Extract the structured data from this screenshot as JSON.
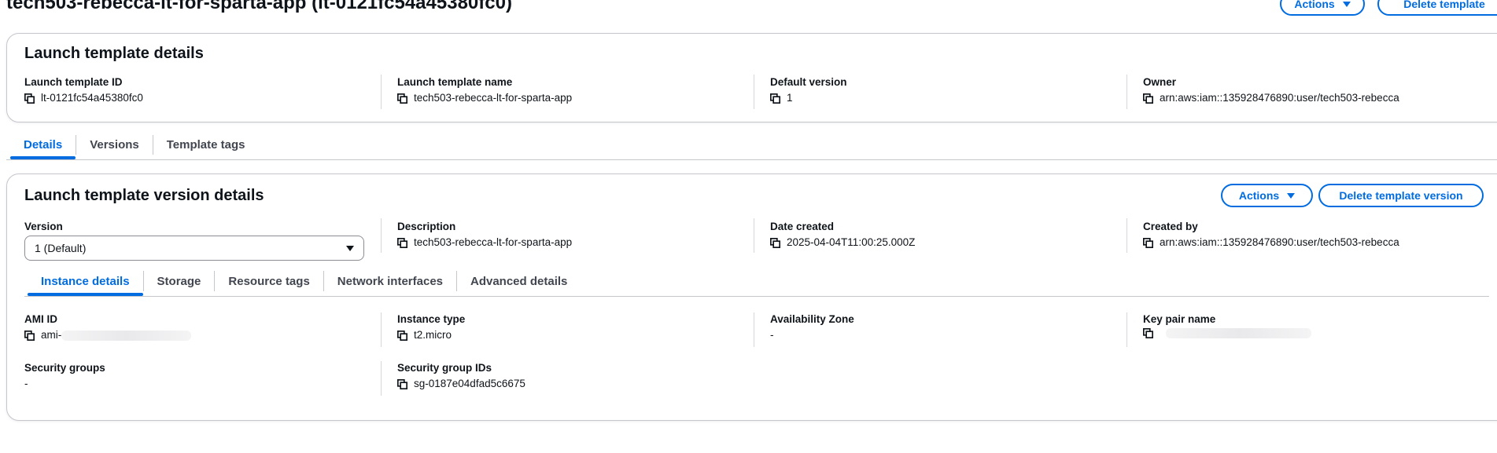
{
  "page": {
    "title": "tech503-rebecca-lt-for-sparta-app (lt-0121fc54a45380fc0)",
    "actions_label": "Actions",
    "delete_label": "Delete template"
  },
  "details_card": {
    "title": "Launch template details",
    "fields": [
      {
        "label": "Launch template ID",
        "value": "lt-0121fc54a45380fc0"
      },
      {
        "label": "Launch template name",
        "value": "tech503-rebecca-lt-for-sparta-app"
      },
      {
        "label": "Default version",
        "value": "1"
      },
      {
        "label": "Owner",
        "value": "arn:aws:iam::135928476890:user/tech503-rebecca"
      }
    ]
  },
  "main_tabs": [
    "Details",
    "Versions",
    "Template tags"
  ],
  "version_card": {
    "title": "Launch template version details",
    "actions_label": "Actions",
    "delete_label": "Delete template version",
    "version": {
      "label": "Version",
      "selected": "1 (Default)"
    },
    "fields": [
      {
        "label": "Description",
        "value": "tech503-rebecca-lt-for-sparta-app"
      },
      {
        "label": "Date created",
        "value": "2025-04-04T11:00:25.000Z"
      },
      {
        "label": "Created by",
        "value": "arn:aws:iam::135928476890:user/tech503-rebecca"
      }
    ],
    "inner_tabs": [
      "Instance details",
      "Storage",
      "Resource tags",
      "Network interfaces",
      "Advanced details"
    ],
    "instance": {
      "ami": {
        "label": "AMI ID",
        "value": "ami-"
      },
      "instance_type": {
        "label": "Instance type",
        "value": "t2.micro"
      },
      "availability_zone": {
        "label": "Availability Zone",
        "value": "-"
      },
      "key_pair": {
        "label": "Key pair name",
        "value": ""
      },
      "security_groups": {
        "label": "Security groups",
        "value": "-"
      },
      "security_group_ids": {
        "label": "Security group IDs",
        "value": "sg-0187e04dfad5c6675"
      }
    }
  },
  "colors": {
    "accent": "#006ce0",
    "text": "#0f141a",
    "border": "#c6c6cd"
  },
  "icons": {
    "copy": "copy-icon",
    "dropdown": "caret-down-icon"
  }
}
